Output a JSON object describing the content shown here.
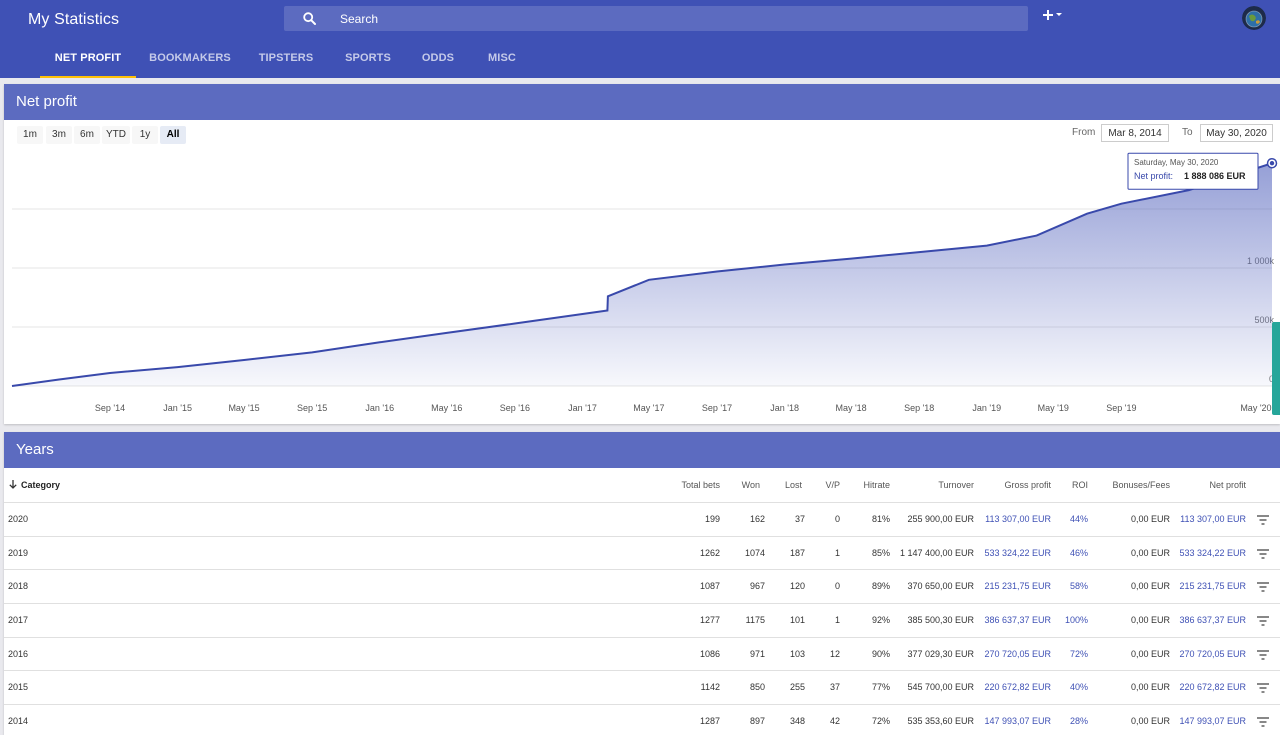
{
  "app": {
    "title": "My Statistics"
  },
  "search": {
    "placeholder": "Search"
  },
  "header": {
    "add_glyph": "+",
    "add_icon": "plus-icon",
    "avatar_icon": "globe-avatar"
  },
  "tabs": [
    {
      "label": "NET PROFIT",
      "active": true
    },
    {
      "label": "BOOKMAKERS",
      "active": false
    },
    {
      "label": "TIPSTERS",
      "active": false
    },
    {
      "label": "SPORTS",
      "active": false
    },
    {
      "label": "ODDS",
      "active": false
    },
    {
      "label": "MISC",
      "active": false
    }
  ],
  "chart_panel": {
    "title": "Net profit",
    "ranges": [
      {
        "label": "1m",
        "active": false
      },
      {
        "label": "3m",
        "active": false
      },
      {
        "label": "6m",
        "active": false
      },
      {
        "label": "YTD",
        "active": false
      },
      {
        "label": "1y",
        "active": false
      },
      {
        "label": "All",
        "active": true
      }
    ],
    "from_label": "From",
    "from_value": "Mar 8, 2014",
    "to_label": "To",
    "to_value": "May 30, 2020"
  },
  "chart_data": {
    "type": "area",
    "title": "",
    "xlabel": "",
    "ylabel": "",
    "x_ticks": [
      "Sep '14",
      "Jan '15",
      "May '15",
      "Sep '15",
      "Jan '16",
      "May '16",
      "Sep '16",
      "Jan '17",
      "May '17",
      "Sep '17",
      "Jan '18",
      "May '18",
      "Sep '18",
      "Jan '19",
      "May '19",
      "Sep '19",
      "May '20"
    ],
    "y_ticks": [
      0,
      500000,
      1000000,
      1500000
    ],
    "y_tick_labels": [
      "0",
      "500k",
      "1 000k",
      ""
    ],
    "ylim": [
      0,
      2000000
    ],
    "grid": true,
    "series": [
      {
        "x": [
          "2014-03-08",
          "2014-06-01",
          "2014-09-01",
          "2015-01-01",
          "2015-05-01",
          "2015-09-01",
          "2016-01-01",
          "2016-05-01",
          "2016-09-01",
          "2017-01-01",
          "2017-02-15",
          "2017-02-16",
          "2017-05-01",
          "2017-09-01",
          "2018-01-01",
          "2018-05-01",
          "2018-09-01",
          "2019-01-01",
          "2019-04-01",
          "2019-07-01",
          "2019-09-01",
          "2020-01-01",
          "2020-05-30"
        ],
        "values": [
          0,
          55000,
          110000,
          160000,
          220000,
          285000,
          370000,
          450000,
          530000,
          610000,
          640000,
          760000,
          900000,
          970000,
          1030000,
          1080000,
          1135000,
          1190000,
          1275000,
          1460000,
          1545000,
          1660000,
          1888086
        ]
      }
    ],
    "tooltip": {
      "date": "Saturday, May 30, 2020",
      "label": "Net profit:",
      "value": "1 888 086 EUR"
    }
  },
  "years_panel": {
    "title": "Years",
    "columns": [
      "Category",
      "Total bets",
      "Won",
      "Lost",
      "V/P",
      "Hitrate",
      "Turnover",
      "Gross profit",
      "ROI",
      "Bonuses/Fees",
      "Net profit"
    ],
    "rows": [
      {
        "category": "2020",
        "total_bets": "199",
        "won": "162",
        "lost": "37",
        "vp": "0",
        "hitrate": "81%",
        "turnover": "255 900,00 EUR",
        "gross_profit": "113 307,00 EUR",
        "roi": "44%",
        "bonuses": "0,00 EUR",
        "net_profit": "113 307,00 EUR"
      },
      {
        "category": "2019",
        "total_bets": "1262",
        "won": "1074",
        "lost": "187",
        "vp": "1",
        "hitrate": "85%",
        "turnover": "1 147 400,00 EUR",
        "gross_profit": "533 324,22 EUR",
        "roi": "46%",
        "bonuses": "0,00 EUR",
        "net_profit": "533 324,22 EUR"
      },
      {
        "category": "2018",
        "total_bets": "1087",
        "won": "967",
        "lost": "120",
        "vp": "0",
        "hitrate": "89%",
        "turnover": "370 650,00 EUR",
        "gross_profit": "215 231,75 EUR",
        "roi": "58%",
        "bonuses": "0,00 EUR",
        "net_profit": "215 231,75 EUR"
      },
      {
        "category": "2017",
        "total_bets": "1277",
        "won": "1175",
        "lost": "101",
        "vp": "1",
        "hitrate": "92%",
        "turnover": "385 500,30 EUR",
        "gross_profit": "386 637,37 EUR",
        "roi": "100%",
        "bonuses": "0,00 EUR",
        "net_profit": "386 637,37 EUR"
      },
      {
        "category": "2016",
        "total_bets": "1086",
        "won": "971",
        "lost": "103",
        "vp": "12",
        "hitrate": "90%",
        "turnover": "377 029,30 EUR",
        "gross_profit": "270 720,05 EUR",
        "roi": "72%",
        "bonuses": "0,00 EUR",
        "net_profit": "270 720,05 EUR"
      },
      {
        "category": "2015",
        "total_bets": "1142",
        "won": "850",
        "lost": "255",
        "vp": "37",
        "hitrate": "77%",
        "turnover": "545 700,00 EUR",
        "gross_profit": "220 672,82 EUR",
        "roi": "40%",
        "bonuses": "0,00 EUR",
        "net_profit": "220 672,82 EUR"
      },
      {
        "category": "2014",
        "total_bets": "1287",
        "won": "897",
        "lost": "348",
        "vp": "42",
        "hitrate": "72%",
        "turnover": "535 353,60 EUR",
        "gross_profit": "147 993,07 EUR",
        "roi": "28%",
        "bonuses": "0,00 EUR",
        "net_profit": "147 993,07 EUR"
      }
    ]
  },
  "colors": {
    "primary": "#3f51b5",
    "panel_header": "#5c6bc0",
    "line": "#3949ab",
    "accent": "#ffc107",
    "side_handle": "#26a69a"
  }
}
